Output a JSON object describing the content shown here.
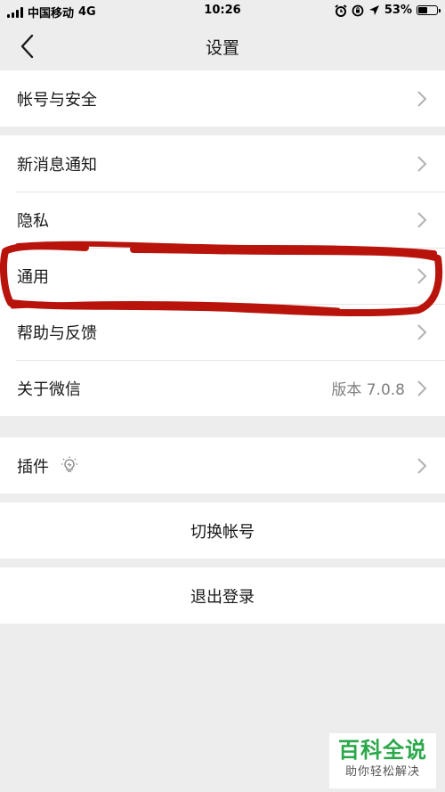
{
  "status_bar": {
    "carrier": "中国移动",
    "network": "4G",
    "time": "10:26",
    "battery": "53%",
    "battery_level": 0.53
  },
  "nav": {
    "title": "设置"
  },
  "groups": {
    "account": {
      "account_security": "帐号与安全"
    },
    "main": {
      "notifications": "新消息通知",
      "privacy": "隐私",
      "general": "通用",
      "help": "帮助与反馈",
      "about": "关于微信",
      "version": "版本 7.0.8"
    },
    "plugins": {
      "label": "插件"
    },
    "switch_account": {
      "label": "切换帐号"
    },
    "logout": {
      "label": "退出登录"
    }
  },
  "watermark": {
    "title": "百科全说",
    "subtitle": "助你轻松解决"
  },
  "colors": {
    "background": "#ededed",
    "annotation": "#b8140c",
    "watermark_green": "#2ba84a"
  }
}
